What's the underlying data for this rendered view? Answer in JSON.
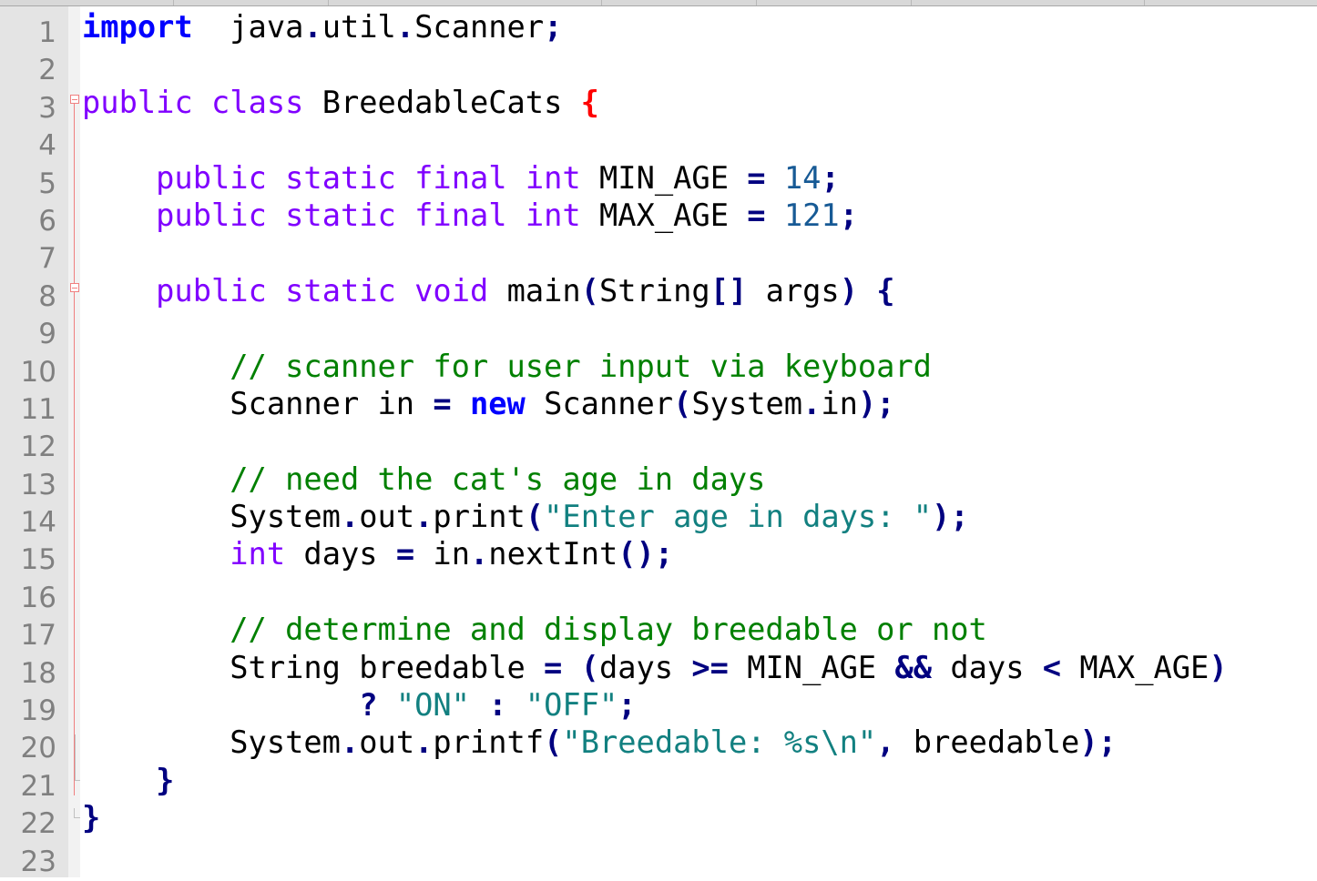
{
  "editor": {
    "line_numbers": [
      "1",
      "2",
      "3",
      "4",
      "5",
      "6",
      "7",
      "8",
      "9",
      "10",
      "11",
      "12",
      "13",
      "14",
      "15",
      "16",
      "17",
      "18",
      "19",
      "20",
      "21",
      "22",
      "23"
    ],
    "colors": {
      "keyword": "#0000ff",
      "type_keyword": "#8000ff",
      "operator": "#000080",
      "number": "#175a95",
      "string": "#128080",
      "comment": "#008000",
      "brace_match": "#ff0000"
    },
    "lines": [
      [
        [
          "kw",
          "import"
        ],
        [
          "",
          "  java"
        ],
        [
          "op",
          "."
        ],
        [
          "",
          "util"
        ],
        [
          "op",
          "."
        ],
        [
          "",
          "Scanner"
        ],
        [
          "op",
          ";"
        ]
      ],
      [],
      [
        [
          "kw2",
          "public"
        ],
        [
          "",
          " "
        ],
        [
          "kw2",
          "class"
        ],
        [
          "",
          " BreedableCats "
        ],
        [
          "brm",
          "{"
        ]
      ],
      [],
      [
        [
          "",
          "    "
        ],
        [
          "kw2",
          "public"
        ],
        [
          "",
          " "
        ],
        [
          "kw2",
          "static"
        ],
        [
          "",
          " "
        ],
        [
          "kw2",
          "final"
        ],
        [
          "",
          " "
        ],
        [
          "kw2",
          "int"
        ],
        [
          "",
          " MIN_AGE "
        ],
        [
          "op",
          "="
        ],
        [
          "",
          " "
        ],
        [
          "num",
          "14"
        ],
        [
          "op",
          ";"
        ]
      ],
      [
        [
          "",
          "    "
        ],
        [
          "kw2",
          "public"
        ],
        [
          "",
          " "
        ],
        [
          "kw2",
          "static"
        ],
        [
          "",
          " "
        ],
        [
          "kw2",
          "final"
        ],
        [
          "",
          " "
        ],
        [
          "kw2",
          "int"
        ],
        [
          "",
          " MAX_AGE "
        ],
        [
          "op",
          "="
        ],
        [
          "",
          " "
        ],
        [
          "num",
          "121"
        ],
        [
          "op",
          ";"
        ]
      ],
      [],
      [
        [
          "",
          "    "
        ],
        [
          "kw2",
          "public"
        ],
        [
          "",
          " "
        ],
        [
          "kw2",
          "static"
        ],
        [
          "",
          " "
        ],
        [
          "kw2",
          "void"
        ],
        [
          "",
          " main"
        ],
        [
          "op",
          "("
        ],
        [
          "",
          "String"
        ],
        [
          "op",
          "[]"
        ],
        [
          "",
          " args"
        ],
        [
          "op",
          ")"
        ],
        [
          "",
          " "
        ],
        [
          "op",
          "{"
        ]
      ],
      [],
      [
        [
          "",
          "        "
        ],
        [
          "cm",
          "// scanner for user input via keyboard"
        ]
      ],
      [
        [
          "",
          "        Scanner in "
        ],
        [
          "op",
          "="
        ],
        [
          "",
          " "
        ],
        [
          "kw",
          "new"
        ],
        [
          "",
          " Scanner"
        ],
        [
          "op",
          "("
        ],
        [
          "",
          "System"
        ],
        [
          "op",
          "."
        ],
        [
          "",
          "in"
        ],
        [
          "op",
          ");"
        ]
      ],
      [],
      [
        [
          "",
          "        "
        ],
        [
          "cm",
          "// need the cat's age in days"
        ]
      ],
      [
        [
          "",
          "        System"
        ],
        [
          "op",
          "."
        ],
        [
          "",
          "out"
        ],
        [
          "op",
          "."
        ],
        [
          "",
          "print"
        ],
        [
          "op",
          "("
        ],
        [
          "str",
          "\"Enter age in days: \""
        ],
        [
          "op",
          ");"
        ]
      ],
      [
        [
          "",
          "        "
        ],
        [
          "kw2",
          "int"
        ],
        [
          "",
          " days "
        ],
        [
          "op",
          "="
        ],
        [
          "",
          " in"
        ],
        [
          "op",
          "."
        ],
        [
          "",
          "nextInt"
        ],
        [
          "op",
          "();"
        ]
      ],
      [],
      [
        [
          "",
          "        "
        ],
        [
          "cm",
          "// determine and display breedable or not"
        ]
      ],
      [
        [
          "",
          "        String breedable "
        ],
        [
          "op",
          "="
        ],
        [
          "",
          " "
        ],
        [
          "op",
          "("
        ],
        [
          "",
          "days "
        ],
        [
          "op",
          ">="
        ],
        [
          "",
          " MIN_AGE "
        ],
        [
          "op",
          "&&"
        ],
        [
          "",
          " days "
        ],
        [
          "op",
          "<"
        ],
        [
          "",
          " MAX_AGE"
        ],
        [
          "op",
          ")"
        ]
      ],
      [
        [
          "",
          "               "
        ],
        [
          "op",
          "?"
        ],
        [
          "",
          " "
        ],
        [
          "str",
          "\"ON\""
        ],
        [
          "",
          " "
        ],
        [
          "op",
          ":"
        ],
        [
          "",
          " "
        ],
        [
          "str",
          "\"OFF\""
        ],
        [
          "op",
          ";"
        ]
      ],
      [
        [
          "",
          "        System"
        ],
        [
          "op",
          "."
        ],
        [
          "",
          "out"
        ],
        [
          "op",
          "."
        ],
        [
          "",
          "printf"
        ],
        [
          "op",
          "("
        ],
        [
          "str",
          "\"Breedable: %s\\n\""
        ],
        [
          "op",
          ","
        ],
        [
          "",
          " breedable"
        ],
        [
          "op",
          ");"
        ]
      ],
      [
        [
          "",
          "    "
        ],
        [
          "op",
          "}"
        ]
      ],
      [
        [
          "op",
          "}"
        ]
      ],
      []
    ]
  }
}
